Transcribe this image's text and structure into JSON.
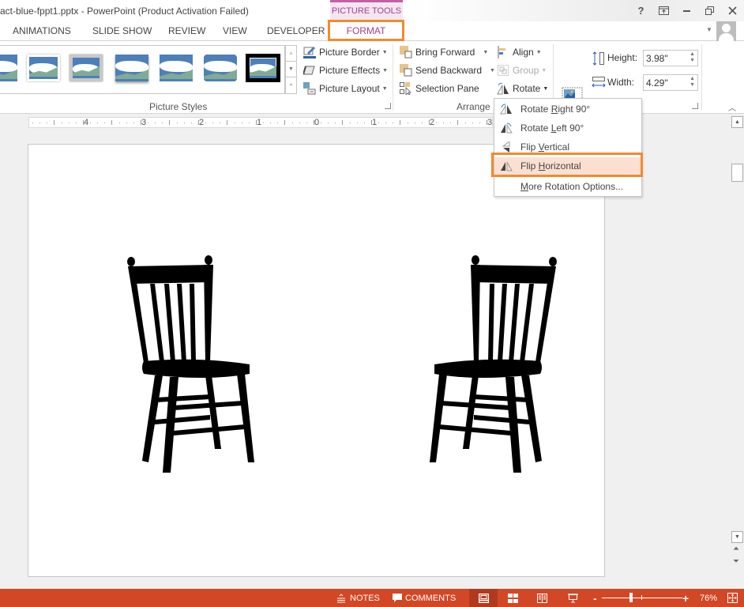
{
  "window": {
    "title": "act-blue-fppt1.pptx - PowerPoint (Product Activation Failed)",
    "context_tab_header": "PICTURE TOOLS",
    "controls": {
      "help": "?",
      "ribbon_display": "⧉",
      "minimize": "—",
      "restore": "❐",
      "close": "✕"
    }
  },
  "tabs": [
    {
      "label": "ANIMATIONS"
    },
    {
      "label": "SLIDE SHOW"
    },
    {
      "label": "REVIEW"
    },
    {
      "label": "VIEW"
    },
    {
      "label": "DEVELOPER"
    },
    {
      "label": "FORMAT",
      "active": true
    }
  ],
  "ribbon": {
    "picture_styles": {
      "label": "Picture Styles",
      "thumbnail_count": 7,
      "selected_index": 6,
      "commands": {
        "border": "Picture Border",
        "effects": "Picture Effects",
        "layout": "Picture Layout"
      }
    },
    "arrange": {
      "label": "Arrange",
      "bring_forward": "Bring Forward",
      "send_backward": "Send Backward",
      "selection_pane": "Selection Pane",
      "align": "Align",
      "group": "Group",
      "rotate": "Rotate"
    },
    "size": {
      "crop": "Crop",
      "height_label": "Height:",
      "height_value": "3.98\"",
      "width_label": "Width:",
      "width_value": "4.29\""
    }
  },
  "ruler": {
    "labels": [
      "4",
      "3",
      "2",
      "1",
      "0",
      "1",
      "2",
      "3"
    ]
  },
  "rotate_menu": {
    "items": [
      {
        "pre": "Rotate ",
        "key": "R",
        "post": "ight 90°",
        "icon": "rotate-right-icon"
      },
      {
        "pre": "Rotate ",
        "key": "L",
        "post": "eft 90°",
        "icon": "rotate-left-icon"
      },
      {
        "pre": "Flip ",
        "key": "V",
        "post": "ertical",
        "icon": "flip-vertical-icon"
      },
      {
        "pre": "Flip ",
        "key": "H",
        "post": "orizontal",
        "icon": "flip-horizontal-icon",
        "highlighted": true
      },
      {
        "pre": "",
        "key": "M",
        "post": "ore Rotation Options...",
        "icon": ""
      }
    ]
  },
  "statusbar": {
    "notes": "NOTES",
    "comments": "COMMENTS",
    "zoom_level": "76%",
    "zoom_minus": "-",
    "zoom_plus": "+",
    "zoom_percent": 76
  },
  "colors": {
    "accent_orange": "#f28a2f",
    "statusbar": "#d24726",
    "picture_tools": "#a43f8c"
  }
}
